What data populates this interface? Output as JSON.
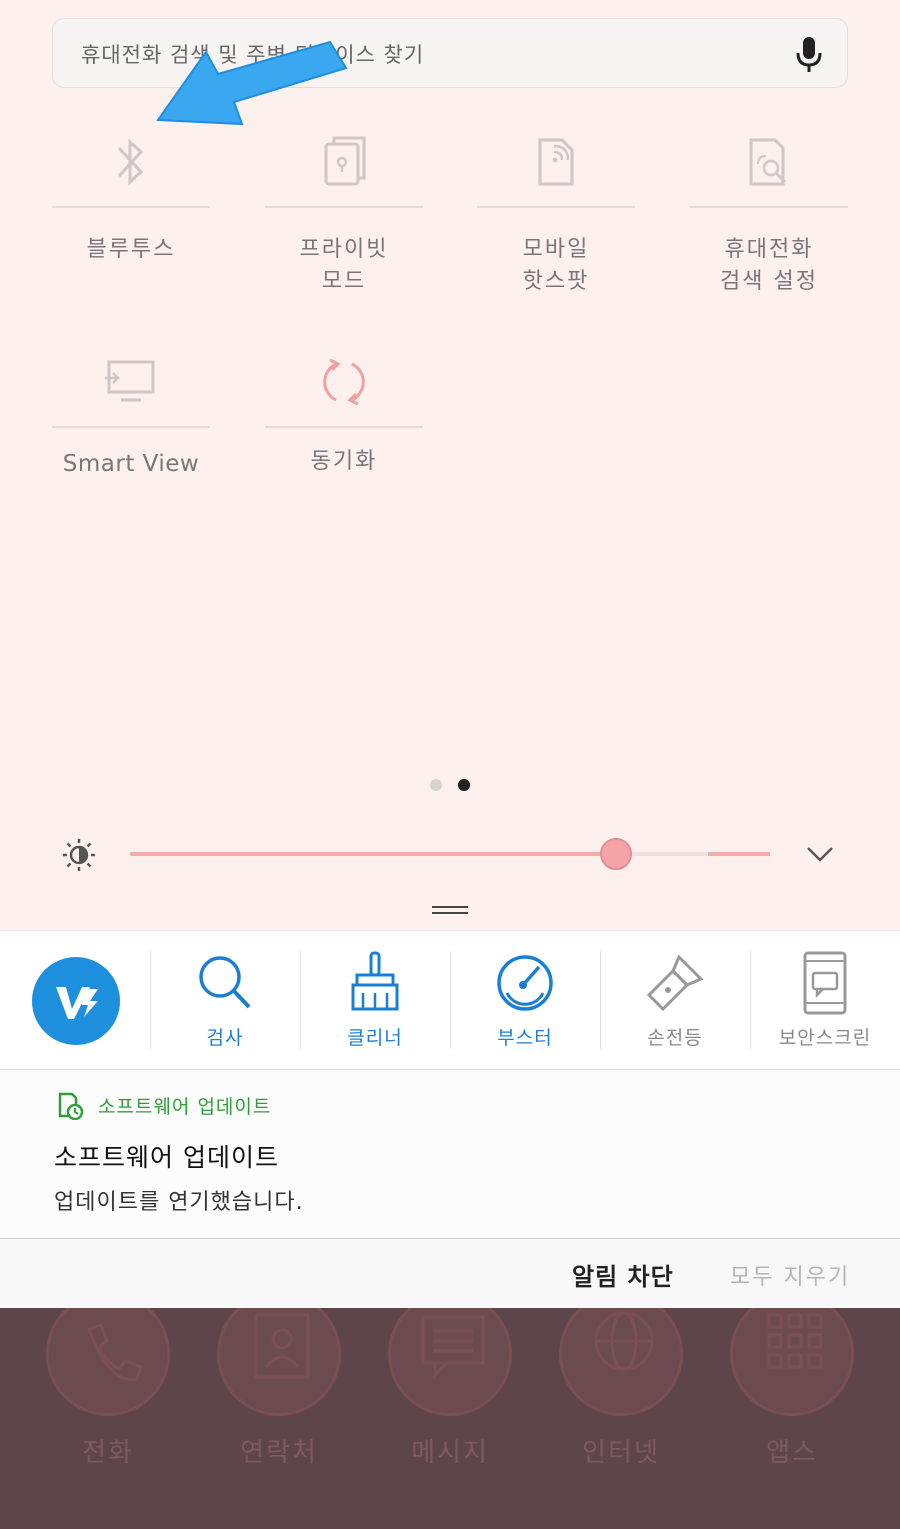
{
  "search": {
    "placeholder": "휴대전화 검색 및 주변 디바이스 찾기"
  },
  "tiles": [
    {
      "label": "블루투스",
      "icon": "bluetooth-icon"
    },
    {
      "label": "프라이빗\n모드",
      "icon": "private-mode-icon"
    },
    {
      "label": "모바일\n핫스팟",
      "icon": "hotspot-icon"
    },
    {
      "label": "휴대전화\n검색 설정",
      "icon": "phone-search-icon"
    },
    {
      "label": "Smart View",
      "icon": "smart-view-icon"
    },
    {
      "label": "동기화",
      "icon": "sync-icon"
    }
  ],
  "pager": {
    "pages": 2,
    "current": 2
  },
  "brightness": {
    "level": 0.76
  },
  "shortcuts": [
    {
      "label": "검사",
      "icon": "search-icon",
      "color": "#1a7fd4"
    },
    {
      "label": "클리너",
      "icon": "broom-icon",
      "color": "#1a7fd4"
    },
    {
      "label": "부스터",
      "icon": "booster-icon",
      "color": "#1a7fd4"
    },
    {
      "label": "손전등",
      "icon": "flashlight-icon",
      "color": "#888888"
    },
    {
      "label": "보안스크린",
      "icon": "secure-screen-icon",
      "color": "#888888"
    }
  ],
  "notification": {
    "app_name": "소프트웨어 업데이트",
    "title": "소프트웨어 업데이트",
    "body": "업데이트를 연기했습니다."
  },
  "actions": {
    "block": "알림 차단",
    "clear_all": "모두 지우기"
  },
  "home_apps": [
    {
      "label": "전화",
      "icon": "phone-icon"
    },
    {
      "label": "연락처",
      "icon": "contacts-icon"
    },
    {
      "label": "메시지",
      "icon": "message-icon"
    },
    {
      "label": "인터넷",
      "icon": "globe-icon"
    },
    {
      "label": "앱스",
      "icon": "apps-grid-icon"
    }
  ],
  "colors": {
    "accent": "#1e8fdc",
    "panel": "#fdf0ed",
    "slider": "#f2aaaa",
    "notif_app": "#2e9e36"
  }
}
